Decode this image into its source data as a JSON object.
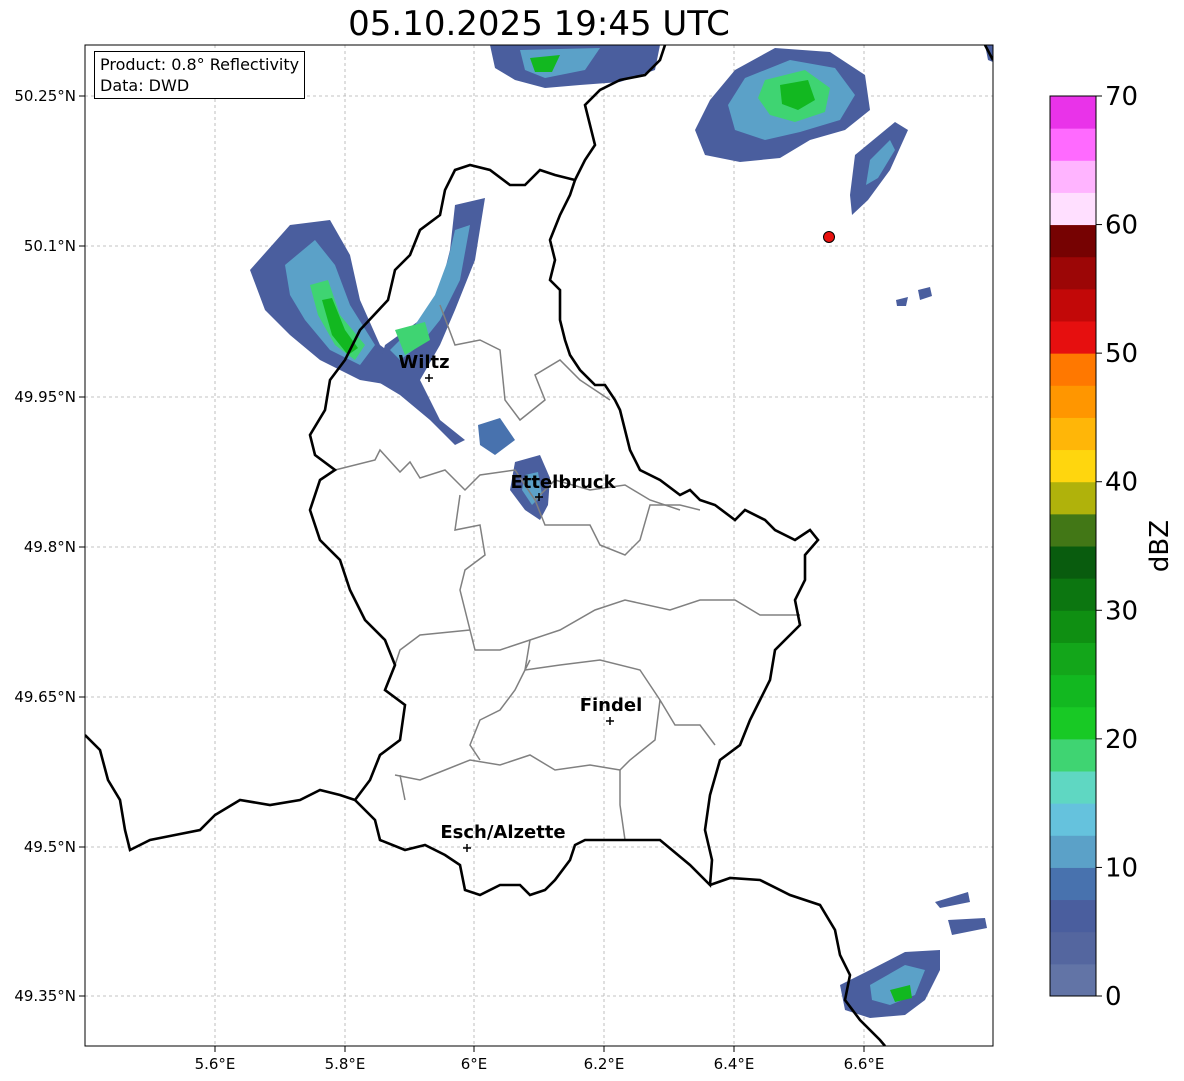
{
  "title": "05.10.2025 19:45 UTC",
  "info": {
    "product": "Product: 0.8° Reflectivity",
    "data": "Data: DWD"
  },
  "axes": {
    "lon_ticks": [
      "5.6°E",
      "5.8°E",
      "6°E",
      "6.2°E",
      "6.4°E",
      "6.6°E"
    ],
    "lat_ticks": [
      "50.25°N",
      "50.1°N",
      "49.95°N",
      "49.8°N",
      "49.65°N",
      "49.5°N",
      "49.35°N"
    ]
  },
  "cities": [
    {
      "name": "Wiltz",
      "lon": 5.93,
      "lat": 49.966
    },
    {
      "name": "Ettelbruck",
      "lon": 6.1,
      "lat": 49.847
    },
    {
      "name": "Findel",
      "lon": 6.21,
      "lat": 49.627
    },
    {
      "name": "Esch/Alzette",
      "lon": 5.99,
      "lat": 49.497
    }
  ],
  "radar_site": {
    "lon": 6.545,
    "lat": 50.11,
    "color": "#e8110f"
  },
  "colorbar": {
    "label": "dBZ",
    "ticks": [
      "0",
      "10",
      "20",
      "30",
      "40",
      "50",
      "60",
      "70"
    ],
    "colors": [
      "#6274a6",
      "#54669f",
      "#4a5e9e",
      "#4872ae",
      "#5ba1c8",
      "#65c2dd",
      "#5fd7c2",
      "#3fd472",
      "#18c925",
      "#12b820",
      "#13a61a",
      "#0f8f12",
      "#0c7610",
      "#095c0e",
      "#427716",
      "#b0b20b",
      "#ffd60e",
      "#ffb608",
      "#ff9600",
      "#ff7800",
      "#e60f0f",
      "#c20808",
      "#9c0606",
      "#760202",
      "#ffdfff",
      "#ffb4ff",
      "#ff6aff",
      "#e933e9"
    ]
  },
  "echoes": [
    {
      "id": "nw-cell",
      "lon": 5.77,
      "lat": 50.01,
      "dbz": 18
    },
    {
      "id": "wiltz-arm",
      "lon": 5.88,
      "lat": 50.04,
      "dbz": 12
    },
    {
      "id": "ettelbruck-cell",
      "lon": 6.09,
      "lat": 49.86,
      "dbz": 9
    },
    {
      "id": "north-edge",
      "lon": 6.1,
      "lat": 50.28,
      "dbz": 12
    },
    {
      "id": "ne-cell",
      "lon": 6.49,
      "lat": 50.24,
      "dbz": 16
    },
    {
      "id": "se-cell",
      "lon": 6.65,
      "lat": 49.35,
      "dbz": 15
    }
  ]
}
